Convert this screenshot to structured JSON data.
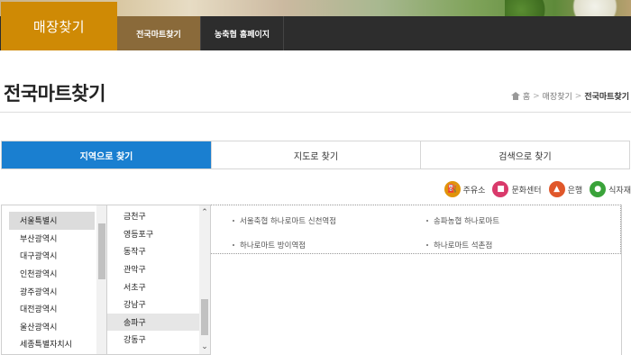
{
  "brand": {
    "title": "매장찾기"
  },
  "gnb": [
    {
      "label": "전국마트찾기",
      "active": true
    },
    {
      "label": "농축협 홈페이지",
      "active": false
    }
  ],
  "page": {
    "title": "전국마트찾기"
  },
  "breadcrumb": {
    "home": "홈",
    "level1": "매장찾기",
    "current": "전국마트찾기"
  },
  "tabs": [
    {
      "label": "지역으로 찾기",
      "active": true
    },
    {
      "label": "지도로 찾기",
      "active": false
    },
    {
      "label": "검색으로 찾기",
      "active": false
    }
  ],
  "legend": [
    {
      "label": "주유소",
      "icon": "gas-station-icon",
      "color": "#e0940a"
    },
    {
      "label": "문화센터",
      "icon": "culture-center-icon",
      "color": "#d93a6b"
    },
    {
      "label": "은행",
      "icon": "bank-icon",
      "color": "#e0572a"
    },
    {
      "label": "식자재",
      "icon": "food-ingredients-icon",
      "color": "#3aa33a"
    }
  ],
  "cities": [
    "서울특별시",
    "부산광역시",
    "대구광역시",
    "인천광역시",
    "광주광역시",
    "대전광역시",
    "울산광역시",
    "세종특별자치시"
  ],
  "selected_city": "서울특별시",
  "districts": [
    "금천구",
    "영등포구",
    "동작구",
    "관악구",
    "서초구",
    "강남구",
    "송파구",
    "강동구"
  ],
  "selected_district": "송파구",
  "results": [
    "서울축협 하나로마트 신천역점",
    "송파농협 하나로마트",
    "하나로마트 방이역점",
    "하나로마트 석촌점"
  ]
}
